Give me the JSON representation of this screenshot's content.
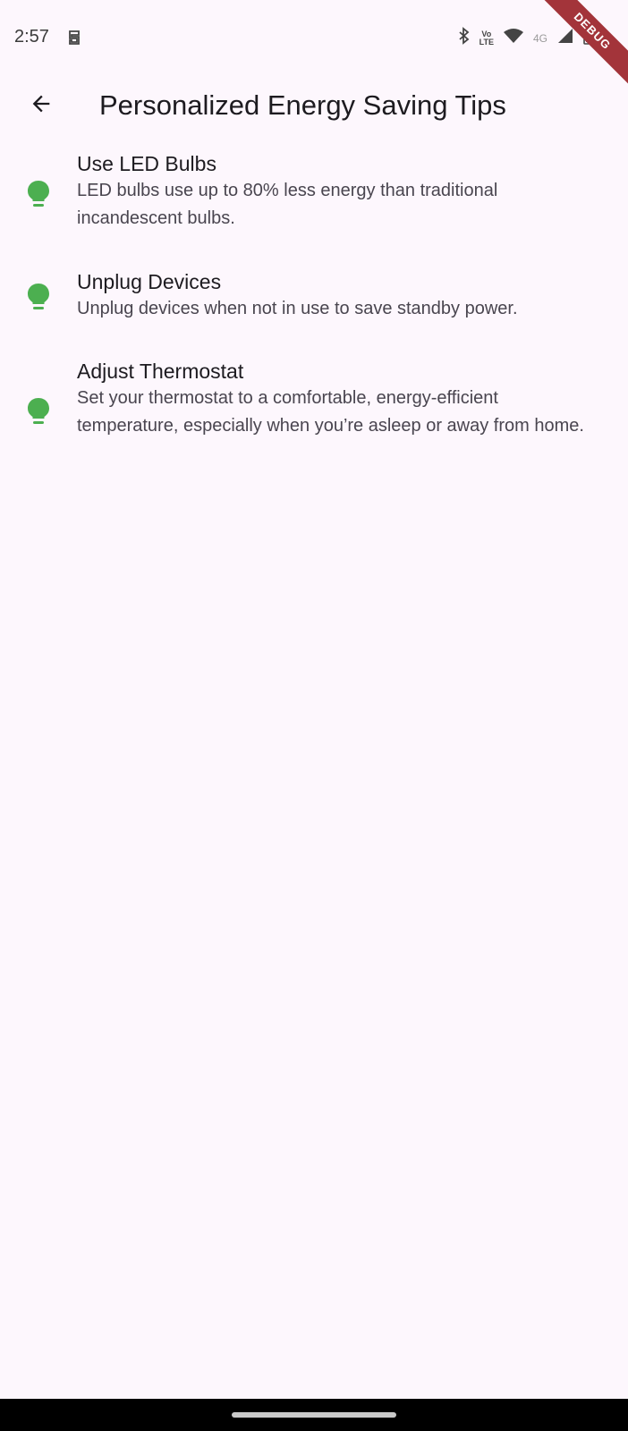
{
  "status_bar": {
    "time": "2:57",
    "volte_top": "Vo",
    "volte_bottom": "LTE",
    "network_label": "4G",
    "debug_label": "DEBUG"
  },
  "app_bar": {
    "title": "Personalized Energy Saving Tips",
    "back_icon": "arrow-back-icon"
  },
  "colors": {
    "background": "#fdf7fd",
    "tip_icon": "#4caf50",
    "debug_banner": "#a3343a"
  },
  "tips": [
    {
      "icon": "lightbulb-icon",
      "title": "Use LED Bulbs",
      "description": "LED bulbs use up to 80% less energy than traditional incandescent bulbs."
    },
    {
      "icon": "lightbulb-icon",
      "title": "Unplug Devices",
      "description": "Unplug devices when not in use to save standby power."
    },
    {
      "icon": "lightbulb-icon",
      "title": "Adjust Thermostat",
      "description": "Set your thermostat to a comfortable, energy-efficient temperature, especially when you’re asleep or away from home."
    }
  ]
}
